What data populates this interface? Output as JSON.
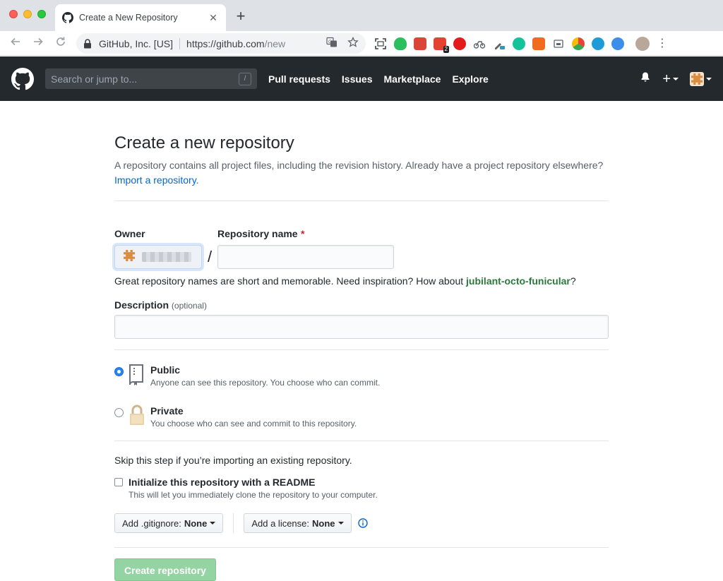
{
  "browser": {
    "tab_title": "Create a New Repository",
    "tab_close": "✕",
    "new_tab": "+",
    "omnibox": {
      "org": "GitHub, Inc. [US]",
      "host": "https://github.com",
      "path": "/new"
    },
    "extension_badge": "2",
    "menu": "⋮"
  },
  "header": {
    "search_placeholder": "Search or jump to...",
    "search_shortcut": "/",
    "nav": [
      "Pull requests",
      "Issues",
      "Marketplace",
      "Explore"
    ],
    "plus": "+"
  },
  "page": {
    "title": "Create a new repository",
    "subtitle": "A repository contains all project files, including the revision history. Already have a project repository elsewhere?",
    "import_link": "Import a repository.",
    "owner_label": "Owner",
    "repo_name_label": "Repository name",
    "required_mark": "*",
    "slash": "/",
    "hint_prefix": "Great repository names are short and memorable. Need inspiration? How about",
    "hint_suggestion": "jubilant-octo-funicular",
    "hint_suffix": "?",
    "description_label": "Description",
    "description_optional": "(optional)",
    "visibility": [
      {
        "title": "Public",
        "desc": "Anyone can see this repository. You choose who can commit.",
        "checked": true
      },
      {
        "title": "Private",
        "desc": "You choose who can see and commit to this repository.",
        "checked": false
      }
    ],
    "skip_text": "Skip this step if you’re importing an existing repository.",
    "init_title": "Initialize this repository with a README",
    "init_desc": "This will let you immediately clone the repository to your computer.",
    "gitignore_label": "Add .gitignore:",
    "gitignore_value": "None",
    "license_label": "Add a license:",
    "license_value": "None",
    "create_button": "Create repository"
  },
  "colors": {
    "header_bg": "#24292e",
    "link": "#0366d6",
    "suggestion": "#2a7a3b",
    "radio_checked": "#2884f6",
    "create_button": "#94d3a2"
  }
}
